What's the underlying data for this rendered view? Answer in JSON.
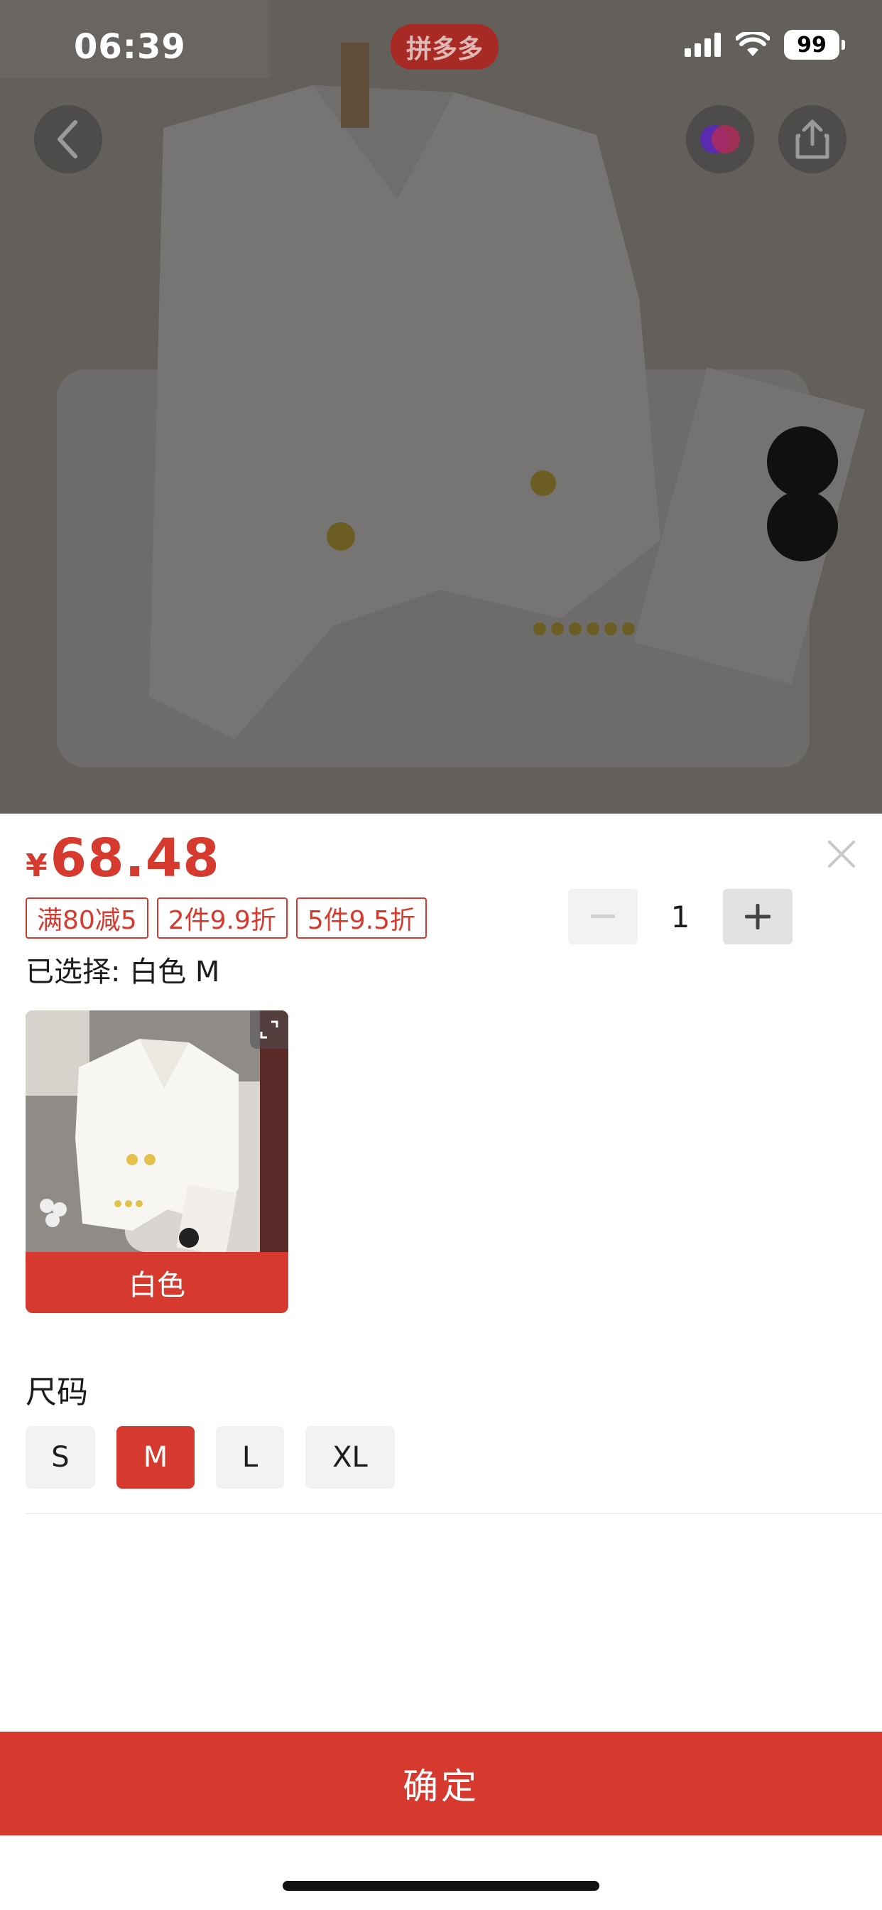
{
  "status_bar": {
    "time": "06:39",
    "battery": "99"
  },
  "brand": "拼多多",
  "product": {
    "price_currency": "¥",
    "price_value": "68.48",
    "promo_tags": [
      "满80减5",
      "2件9.9折",
      "5件9.5折"
    ],
    "selected_text": "已选择: 白色 M"
  },
  "quantity": {
    "minus": "−",
    "value": "1",
    "plus": "+"
  },
  "color_options": [
    {
      "label": "白色",
      "selected": true
    }
  ],
  "size_section": {
    "title": "尺码",
    "options": [
      "S",
      "M",
      "L",
      "XL"
    ],
    "selected": "M"
  },
  "confirm_label": "确定",
  "colors": {
    "accent": "#d63a2f"
  },
  "icons": [
    "back-icon",
    "ai-assistant-icon",
    "share-icon",
    "close-icon",
    "expand-icon",
    "signal-icon",
    "wifi-icon",
    "battery-icon"
  ]
}
